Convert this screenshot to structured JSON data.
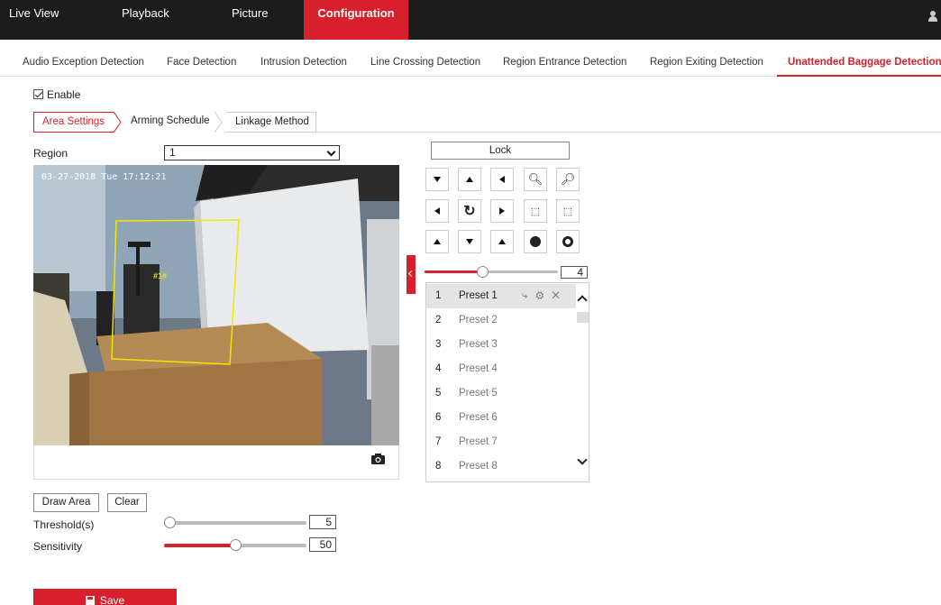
{
  "topnav": {
    "items": [
      "Live View",
      "Playback",
      "Picture",
      "Configuration"
    ],
    "active": "Configuration"
  },
  "subtabs": [
    "Audio Exception Detection",
    "Face Detection",
    "Intrusion Detection",
    "Line Crossing Detection",
    "Region Entrance Detection",
    "Region Exiting Detection",
    "Unattended Baggage Detection"
  ],
  "enable": {
    "label": "Enable",
    "checked": true
  },
  "steps": [
    "Area Settings",
    "Arming Schedule",
    "Linkage Method"
  ],
  "region": {
    "label": "Region",
    "value": "1"
  },
  "video": {
    "osd": "03-27-2018 Tue 17:12:21",
    "region_tag": "#1#"
  },
  "buttons": {
    "draw": "Draw Area",
    "clear": "Clear",
    "save": "Save",
    "lock": "Lock"
  },
  "threshold": {
    "label": "Threshold(s)",
    "value": "5",
    "level": 0.0
  },
  "sensitivity": {
    "label": "Sensitivity",
    "value": "50",
    "level": 0.5
  },
  "ptz": {
    "speed": "4",
    "speed_level": 0.43
  },
  "presets": [
    {
      "num": "1",
      "name": "Preset 1"
    },
    {
      "num": "2",
      "name": "Preset 2"
    },
    {
      "num": "3",
      "name": "Preset 3"
    },
    {
      "num": "4",
      "name": "Preset 4"
    },
    {
      "num": "5",
      "name": "Preset 5"
    },
    {
      "num": "6",
      "name": "Preset 6"
    },
    {
      "num": "7",
      "name": "Preset 7"
    },
    {
      "num": "8",
      "name": "Preset 8"
    }
  ],
  "colors": {
    "accent": "#d7202b",
    "nav_bg": "#1c1c1c",
    "detection_box": "#f2e600"
  }
}
